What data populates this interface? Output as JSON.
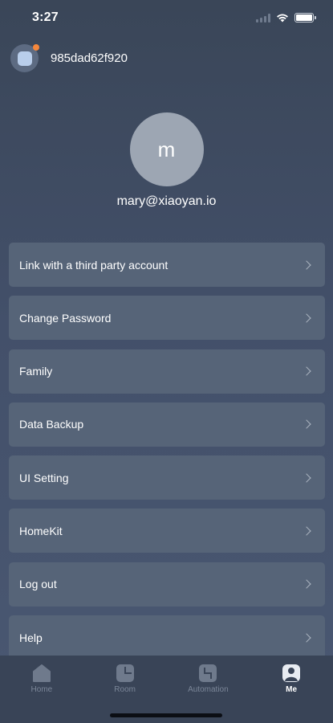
{
  "status": {
    "time": "3:27"
  },
  "device": {
    "name": "985dad62f920",
    "dot_color": "#f5873c"
  },
  "profile": {
    "initial": "m",
    "email": "mary@xiaoyan.io"
  },
  "menu": {
    "items": [
      {
        "label": "Link with a third party account"
      },
      {
        "label": "Change Password"
      },
      {
        "label": "Family"
      },
      {
        "label": "Data Backup"
      },
      {
        "label": "UI Setting"
      },
      {
        "label": "HomeKit"
      },
      {
        "label": "Log out"
      },
      {
        "label": "Help"
      }
    ]
  },
  "tabs": [
    {
      "label": "Home",
      "icon": "home-icon",
      "active": false
    },
    {
      "label": "Room",
      "icon": "room-icon",
      "active": false
    },
    {
      "label": "Automation",
      "icon": "automation-icon",
      "active": false
    },
    {
      "label": "Me",
      "icon": "me-icon",
      "active": true
    }
  ],
  "colors": {
    "background": "#43506a",
    "menu_item": "#566478",
    "tabbar": "#394457"
  }
}
